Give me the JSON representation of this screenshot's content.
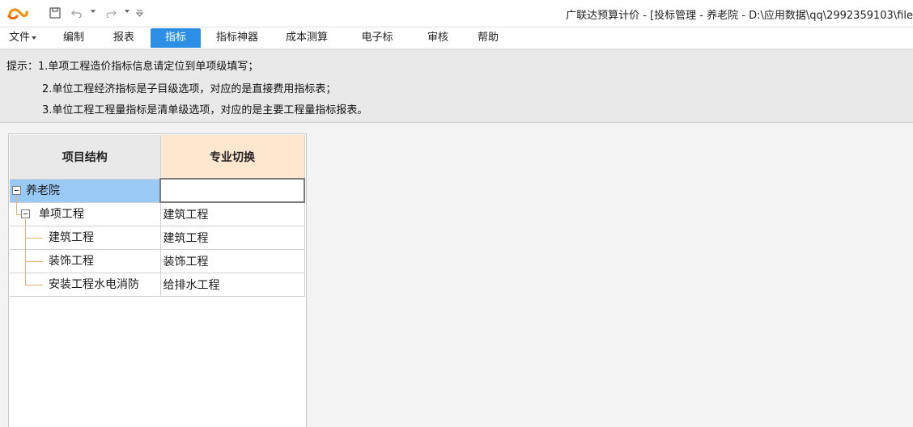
{
  "app": {
    "logo_icon": "glodon-logo-icon",
    "title": "广联达预算计价 - [投标管理 - 养老院 - D:\\应用数据\\qq\\2992359103\\file"
  },
  "quick_access": [
    "save-icon",
    "undo-icon",
    "redo-icon",
    "customize-icon"
  ],
  "menu": {
    "items": [
      {
        "label": "文件"
      },
      {
        "label": "编制"
      },
      {
        "label": "报表"
      },
      {
        "label": "指标"
      },
      {
        "label": "指标神器"
      },
      {
        "label": "成本测算"
      },
      {
        "label": "电子标"
      },
      {
        "label": "审核"
      },
      {
        "label": "帮助"
      }
    ],
    "active_index": 3,
    "active_color": "#2d8fe3"
  },
  "tips": {
    "prefix": "提示：",
    "lines": [
      "1.单项工程造价指标信息请定位到单项级填写；",
      "2.单位工程经济指标是子目级选项，对应的是直接费用指标表；",
      "3.单位工程工程量指标是清单级选项，对应的是主要工程量指标报表。"
    ]
  },
  "grid": {
    "columns": [
      "项目结构",
      "专业切换"
    ],
    "rows": [
      {
        "name": "养老院",
        "major": ""
      },
      {
        "name": "单项工程",
        "major": "建筑工程"
      },
      {
        "name": "建筑工程",
        "major": "建筑工程"
      },
      {
        "name": "装饰工程",
        "major": "装饰工程"
      },
      {
        "name": "安装工程水电消防",
        "major": "给排水工程"
      }
    ],
    "selected_row": 0,
    "selected_color": "#99c9f5",
    "header_highlight_color": "#fde7cf"
  }
}
